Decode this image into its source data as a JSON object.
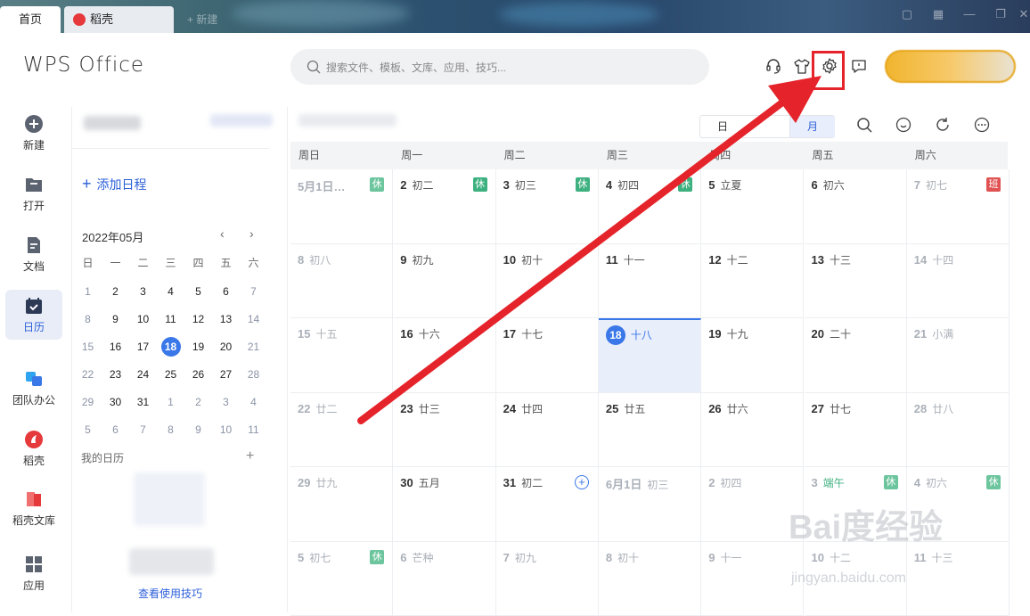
{
  "titlebar": {
    "tabs": [
      {
        "label": "首页"
      },
      {
        "label": "稻壳"
      }
    ],
    "new_tab": "+ 新建"
  },
  "header": {
    "logo": "WPS Office",
    "search_placeholder": "搜索文件、模板、文库、应用、技巧..."
  },
  "nav": [
    {
      "label": "新建",
      "icon": "plus-circle-icon"
    },
    {
      "label": "打开",
      "icon": "folder-icon"
    },
    {
      "label": "文档",
      "icon": "document-icon"
    },
    {
      "label": "日历",
      "icon": "calendar-icon"
    },
    {
      "label": "团队办公",
      "icon": "team-icon"
    },
    {
      "label": "稻壳",
      "icon": "docer-icon"
    },
    {
      "label": "稻壳文库",
      "icon": "library-icon"
    },
    {
      "label": "应用",
      "icon": "apps-grid-icon"
    }
  ],
  "sidebar": {
    "add_schedule": "添加日程",
    "month_title": "2022年05月",
    "weekdays": [
      "日",
      "一",
      "二",
      "三",
      "四",
      "五",
      "六"
    ],
    "weeks": [
      [
        "1",
        "2",
        "3",
        "4",
        "5",
        "6",
        "7"
      ],
      [
        "8",
        "9",
        "10",
        "11",
        "12",
        "13",
        "14"
      ],
      [
        "15",
        "16",
        "17",
        "18",
        "19",
        "20",
        "21"
      ],
      [
        "22",
        "23",
        "24",
        "25",
        "26",
        "27",
        "28"
      ],
      [
        "29",
        "30",
        "31",
        "1",
        "2",
        "3",
        "4"
      ],
      [
        "5",
        "6",
        "7",
        "8",
        "9",
        "10",
        "11"
      ]
    ],
    "today": "18",
    "my_calendar": "我的日历",
    "tips": "查看使用技巧"
  },
  "view_switch": {
    "day": "日",
    "month": "月"
  },
  "calendar": {
    "weekdays": [
      "周日",
      "周一",
      "周二",
      "周三",
      "周四",
      "周五",
      "周六"
    ],
    "rows": [
      [
        {
          "d": "5月1日…",
          "l": "",
          "tag": "休"
        },
        {
          "d": "2",
          "l": "初二",
          "tag": "休"
        },
        {
          "d": "3",
          "l": "初三",
          "tag": "休"
        },
        {
          "d": "4",
          "l": "初四",
          "tag": "休"
        },
        {
          "d": "5",
          "l": "立夏"
        },
        {
          "d": "6",
          "l": "初六"
        },
        {
          "d": "7",
          "l": "初七",
          "tag": "班"
        }
      ],
      [
        {
          "d": "8",
          "l": "初八"
        },
        {
          "d": "9",
          "l": "初九"
        },
        {
          "d": "10",
          "l": "初十"
        },
        {
          "d": "11",
          "l": "十一"
        },
        {
          "d": "12",
          "l": "十二"
        },
        {
          "d": "13",
          "l": "十三"
        },
        {
          "d": "14",
          "l": "十四"
        }
      ],
      [
        {
          "d": "15",
          "l": "十五"
        },
        {
          "d": "16",
          "l": "十六"
        },
        {
          "d": "17",
          "l": "十七"
        },
        {
          "d": "18",
          "l": "十八"
        },
        {
          "d": "19",
          "l": "十九"
        },
        {
          "d": "20",
          "l": "二十"
        },
        {
          "d": "21",
          "l": "小满"
        }
      ],
      [
        {
          "d": "22",
          "l": "廿二"
        },
        {
          "d": "23",
          "l": "廿三"
        },
        {
          "d": "24",
          "l": "廿四"
        },
        {
          "d": "25",
          "l": "廿五"
        },
        {
          "d": "26",
          "l": "廿六"
        },
        {
          "d": "27",
          "l": "廿七"
        },
        {
          "d": "28",
          "l": "廿八"
        }
      ],
      [
        {
          "d": "29",
          "l": "廿九"
        },
        {
          "d": "30",
          "l": "五月"
        },
        {
          "d": "31",
          "l": "初二"
        },
        {
          "d": "6月1日",
          "l": "初三"
        },
        {
          "d": "2",
          "l": "初四"
        },
        {
          "d": "3",
          "l": "端午",
          "tag": "休"
        },
        {
          "d": "4",
          "l": "初六",
          "tag": "休"
        }
      ],
      [
        {
          "d": "5",
          "l": "初七",
          "tag": "休"
        },
        {
          "d": "6",
          "l": "芒种"
        },
        {
          "d": "7",
          "l": "初九"
        },
        {
          "d": "8",
          "l": "初十"
        },
        {
          "d": "9",
          "l": "十一"
        },
        {
          "d": "10",
          "l": "十二"
        },
        {
          "d": "11",
          "l": "十三"
        }
      ]
    ],
    "today": "18"
  },
  "watermark": {
    "text": "Bai度经验",
    "url": "jingyan.baidu.com"
  },
  "colors": {
    "accent": "#3a77e8",
    "annotation": "#e5232a",
    "rest_tag": "#3db07f",
    "work_tag": "#e05252"
  }
}
